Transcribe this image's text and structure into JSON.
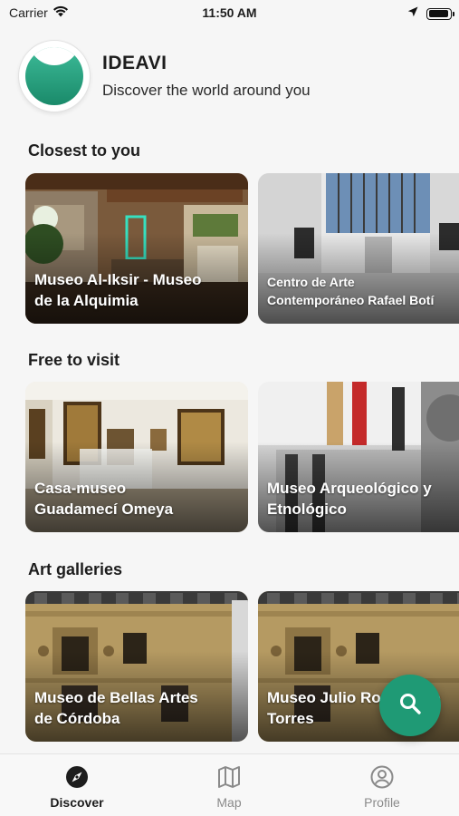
{
  "status_bar": {
    "carrier": "Carrier",
    "time": "11:50 AM",
    "battery_level": 0.95
  },
  "header": {
    "app_name": "IDEAVI",
    "tagline": "Discover the world around you",
    "brand_color": "#1f9a75"
  },
  "sections": [
    {
      "title": "Closest to you",
      "cards": [
        {
          "label": "Museo Al-Iksir - Museo\nde la Alquimia",
          "image": "alchemy-museum-interior"
        },
        {
          "label": "Centro de Arte\nContemporáneo Rafael Botí",
          "image": "skylight-atrium"
        }
      ]
    },
    {
      "title": "Free to visit",
      "cards": [
        {
          "label": "Casa-museo\nGuadamecí Omeya",
          "image": "leather-art-gallery"
        },
        {
          "label": "Museo Arqueológico y\nEtnológico",
          "image": "museum-facade-banners"
        }
      ]
    },
    {
      "title": "Art galleries",
      "cards": [
        {
          "label": "Museo de Bellas Artes\nde Córdoba",
          "image": "stone-facade"
        },
        {
          "label": "Museo Julio Romero de\nTorres",
          "image": "stone-facade"
        }
      ]
    }
  ],
  "fab": {
    "icon": "search-icon"
  },
  "tabs": [
    {
      "label": "Discover",
      "icon": "compass-icon",
      "active": true
    },
    {
      "label": "Map",
      "icon": "map-icon",
      "active": false
    },
    {
      "label": "Profile",
      "icon": "profile-icon",
      "active": false
    }
  ]
}
